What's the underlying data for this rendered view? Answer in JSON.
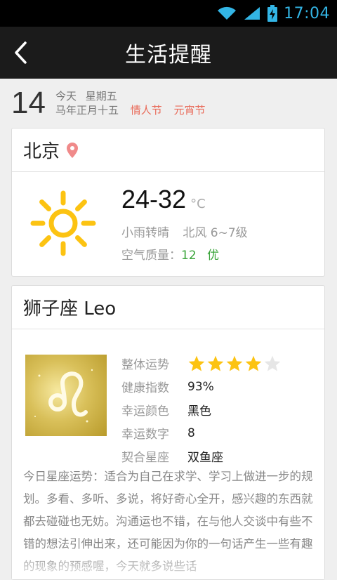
{
  "status_bar": {
    "time": "17:04"
  },
  "title_bar": {
    "title": "生活提醒"
  },
  "date": {
    "day": "14",
    "today": "今天",
    "weekday": "星期五",
    "lunar": "马年正月十五",
    "festivals": [
      "情人节",
      "元宵节"
    ]
  },
  "weather": {
    "city": "北京",
    "temperature": "24-32",
    "unit": "°C",
    "condition": "小雨转晴",
    "wind": "北风 6~7级",
    "aqi_label": "空气质量：",
    "aqi_value": "12",
    "aqi_level": "优",
    "colors": {
      "sun": "#fcc312",
      "location_pin": "#f08a8a",
      "aqi": "#3aa43a"
    }
  },
  "horoscope": {
    "title": "狮子座 Leo",
    "rows": [
      {
        "key": "整体运势",
        "type": "stars",
        "rating": 4,
        "max": 5
      },
      {
        "key": "健康指数",
        "value": "93%"
      },
      {
        "key": "幸运颜色",
        "value": "黑色"
      },
      {
        "key": "幸运数字",
        "value": "8"
      },
      {
        "key": "契合星座",
        "value": "双鱼座"
      }
    ],
    "description": "今日星座运势：适合为自己在求学、学习上做进一步的规划。多看、多听、多说，将好奇心全开，感兴趣的东西就都去碰碰也无妨。沟通运也不错，在与他人交谈中有些不错的想法引伸出来，还可能因为你的一句话产生一些有趣的现象的预感喔，今天就多说些话",
    "colors": {
      "star_on": "#fcc312",
      "star_off": "#e6e6e6"
    }
  }
}
